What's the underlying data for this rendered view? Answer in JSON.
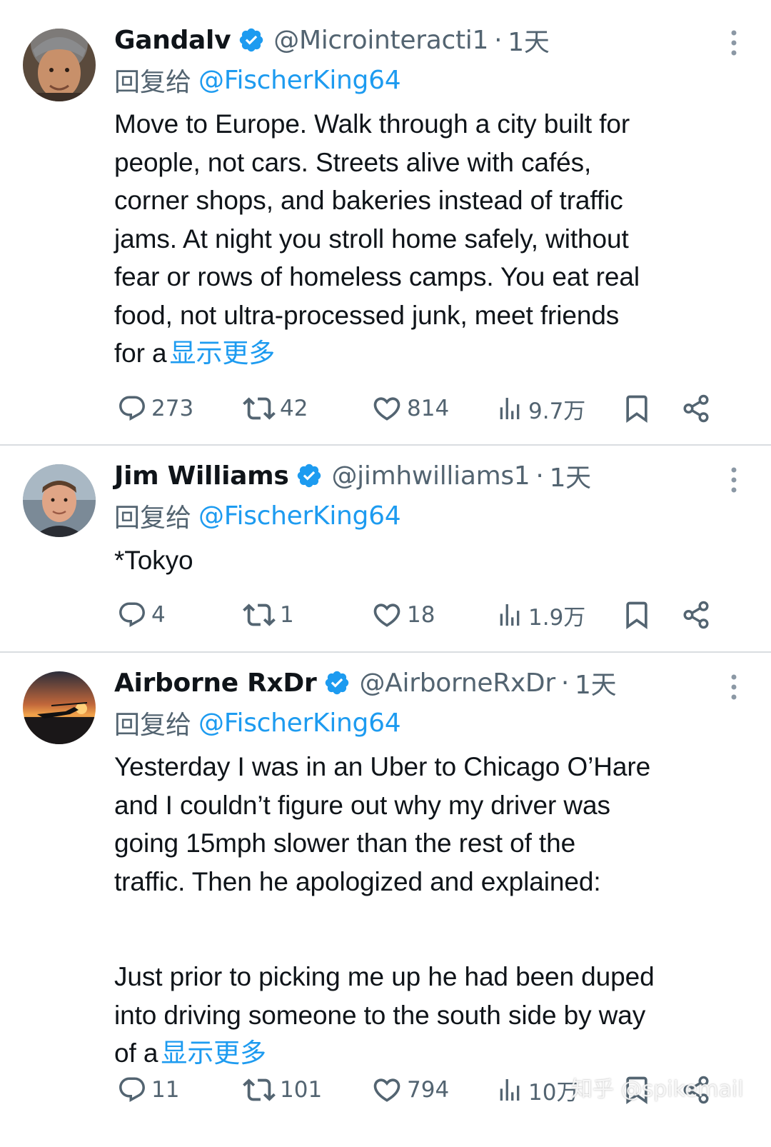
{
  "tweets": [
    {
      "name": "Gandalv",
      "handle": "@Microinteracti1",
      "separator": "·",
      "time": "1天",
      "reply_prefix": "回复给",
      "reply_target": "@FischerKing64",
      "lines": [
        "Move to Europe. Walk through a city built for",
        "people, not cars. Streets alive with cafés,",
        "corner shops, and bakeries instead of traffic",
        "jams. At night you stroll home safely, without",
        "fear or rows of homeless camps. You eat real",
        "food, not ultra-processed junk, meet friends",
        "for a"
      ],
      "show_more": "显示更多",
      "replies": "273",
      "reposts": "42",
      "likes": "814",
      "views": "9.7万"
    },
    {
      "name": "Jim Williams",
      "handle": "@jimhwilliams1",
      "separator": "·",
      "time": "1天",
      "reply_prefix": "回复给",
      "reply_target": "@FischerKing64",
      "lines": [
        "*Tokyo"
      ],
      "show_more": "",
      "replies": "4",
      "reposts": "1",
      "likes": "18",
      "views": "1.9万"
    },
    {
      "name": "Airborne RxDr",
      "handle": "@AirborneRxDr",
      "separator": "·",
      "time": "1天",
      "reply_prefix": "回复给",
      "reply_target": "@FischerKing64",
      "lines": [
        "Yesterday I was in an Uber to Chicago O’Hare",
        "and I couldn’t figure out why my driver was",
        "going 15mph slower than the rest of the",
        "traffic.  Then he apologized and explained:",
        "",
        "Just prior to picking me up he had been duped",
        "into driving someone to the south side by way",
        "of a"
      ],
      "show_more": "显示更多",
      "replies": "11",
      "reposts": "101",
      "likes": "794",
      "views": "10万"
    }
  ],
  "watermark": "知乎 @spikemail",
  "colors": {
    "accent": "#1d9bf0",
    "muted": "#536471",
    "text": "#0f1419",
    "divider": "#d9dde1"
  },
  "icons": [
    "verified-badge-icon",
    "more-options-icon",
    "reply-icon",
    "repost-icon",
    "like-icon",
    "views-icon",
    "bookmark-icon",
    "share-icon"
  ]
}
